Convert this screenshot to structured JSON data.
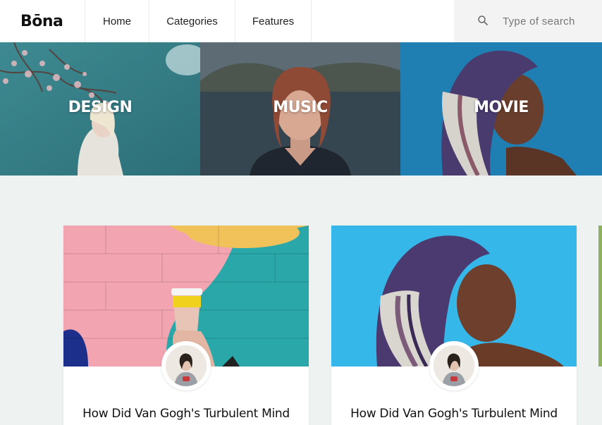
{
  "header": {
    "logo": "Bōna",
    "nav": [
      {
        "label": "Home"
      },
      {
        "label": "Categories"
      },
      {
        "label": "Features"
      }
    ],
    "search": {
      "placeholder": "Type of search",
      "icon": "search-icon"
    }
  },
  "categories": [
    {
      "label": "DESIGN"
    },
    {
      "label": "MUSIC"
    },
    {
      "label": "MOVIE"
    }
  ],
  "posts": [
    {
      "title": "How Did Van Gogh's Turbulent Mind"
    },
    {
      "title": "How Did Van Gogh's Turbulent Mind"
    }
  ]
}
